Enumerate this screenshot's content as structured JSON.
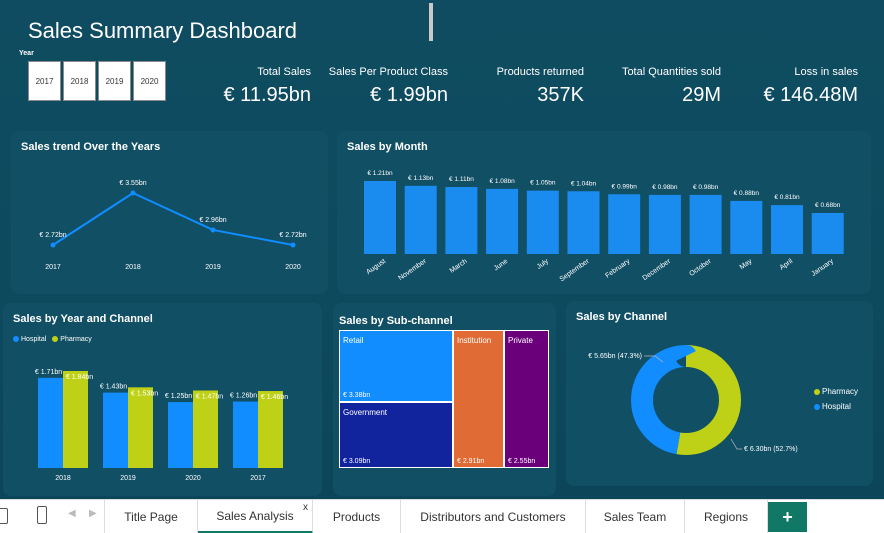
{
  "title": "Sales Summary Dashboard",
  "year_slicer": {
    "label": "Year",
    "options": [
      "2017",
      "2018",
      "2019",
      "2020"
    ]
  },
  "kpis": [
    {
      "label": "Total Sales",
      "value": "€ 11.95bn"
    },
    {
      "label": "Sales Per Product Class",
      "value": "€ 1.99bn"
    },
    {
      "label": "Products returned",
      "value": "357K"
    },
    {
      "label": "Total Quantities sold",
      "value": "29M"
    },
    {
      "label": "Loss in sales",
      "value": "€ 146.48M"
    }
  ],
  "colors": {
    "hospital": "#118dff",
    "pharmacy": "#bfd117",
    "bar": "#1a8cf0",
    "background": "#0e4a5e"
  },
  "panels": {
    "trend": {
      "title": "Sales trend Over the Years"
    },
    "month": {
      "title": "Sales by Month"
    },
    "year_channel": {
      "title": "Sales by Year and Channel",
      "legend": [
        "Hospital",
        "Pharmacy"
      ]
    },
    "subchannel": {
      "title": "Sales by Sub-channel"
    },
    "channel": {
      "title": "Sales by Channel",
      "legend": [
        "Pharmacy",
        "Hospital"
      ]
    }
  },
  "chart_data": [
    {
      "type": "line",
      "title": "Sales trend Over the Years",
      "categories": [
        "2017",
        "2018",
        "2019",
        "2020"
      ],
      "values": [
        2.72,
        3.55,
        2.96,
        2.72
      ],
      "labels": [
        "€ 2.72bn",
        "€ 3.55bn",
        "€ 2.96bn",
        "€ 2.72bn"
      ]
    },
    {
      "type": "bar",
      "title": "Sales by Month",
      "categories": [
        "August",
        "November",
        "March",
        "June",
        "July",
        "September",
        "February",
        "December",
        "October",
        "May",
        "April",
        "January"
      ],
      "values": [
        1.21,
        1.13,
        1.11,
        1.08,
        1.05,
        1.04,
        0.99,
        0.98,
        0.98,
        0.88,
        0.81,
        0.68
      ],
      "labels": [
        "€ 1.21bn",
        "€ 1.13bn",
        "€ 1.11bn",
        "€ 1.08bn",
        "€ 1.05bn",
        "€ 1.04bn",
        "€ 0.99bn",
        "€ 0.98bn",
        "€ 0.98bn",
        "€ 0.88bn",
        "€ 0.81bn",
        "€ 0.68bn"
      ]
    },
    {
      "type": "bar",
      "title": "Sales by Year and Channel",
      "categories": [
        "2018",
        "2019",
        "2020",
        "2017"
      ],
      "series": [
        {
          "name": "Hospital",
          "values": [
            1.71,
            1.43,
            1.25,
            1.26
          ],
          "labels": [
            "€ 1.71bn",
            "€ 1.43bn",
            "€ 1.25bn",
            "€ 1.26bn"
          ]
        },
        {
          "name": "Pharmacy",
          "values": [
            1.84,
            1.53,
            1.47,
            1.46
          ],
          "labels": [
            "€ 1.84bn",
            "€ 1.53bn",
            "€ 1.47bn",
            "€ 1.46bn"
          ]
        }
      ]
    },
    {
      "type": "treemap",
      "title": "Sales by Sub-channel",
      "items": [
        {
          "name": "Retail",
          "value": 3.38,
          "label": "€ 3.38bn",
          "color": "#118dff"
        },
        {
          "name": "Government",
          "value": 3.09,
          "label": "€ 3.09bn",
          "color": "#12239e"
        },
        {
          "name": "Institution",
          "value": 2.91,
          "label": "€ 2.91bn",
          "color": "#e66c37"
        },
        {
          "name": "Private",
          "value": 2.55,
          "label": "€ 2.55bn",
          "color": "#6b007b"
        }
      ]
    },
    {
      "type": "pie",
      "title": "Sales by Channel",
      "donut": true,
      "slices": [
        {
          "name": "Pharmacy",
          "value": 52.7,
          "label": "€ 6.30bn (52.7%)",
          "color": "#bfd117"
        },
        {
          "name": "Hospital",
          "value": 47.3,
          "label": "€ 5.65bn (47.3%)",
          "color": "#118dff"
        }
      ]
    }
  ],
  "tabbar": {
    "tabs": [
      "Title Page",
      "Sales Analysis",
      "Products",
      "Distributors and Customers",
      "Sales Team",
      "Regions"
    ],
    "active": "Sales Analysis",
    "close_glyph": "x",
    "add_glyph": "+"
  }
}
